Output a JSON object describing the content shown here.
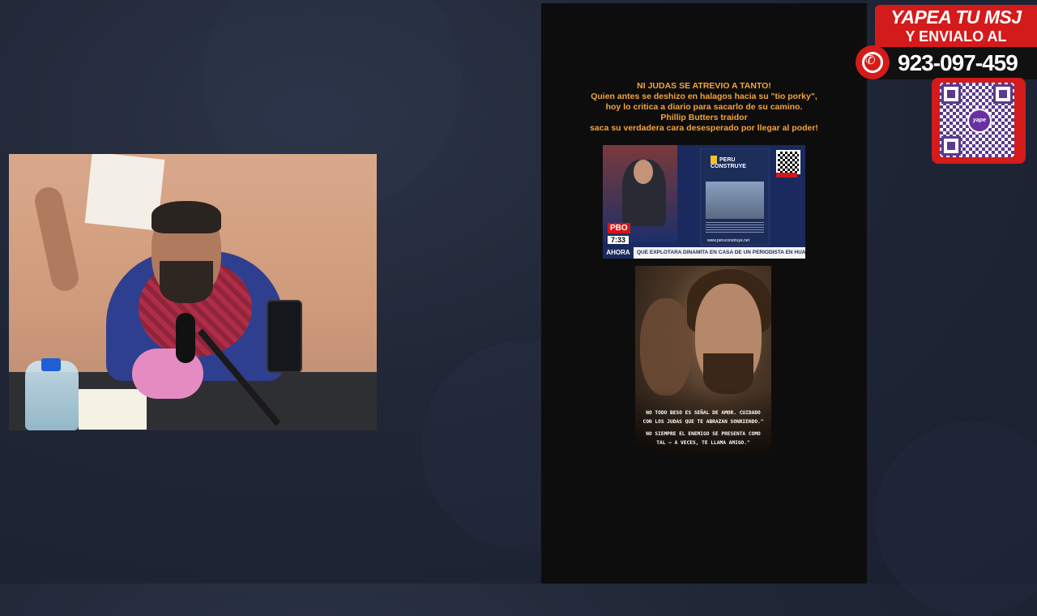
{
  "center": {
    "headline_lines": [
      "NI JUDAS SE ATREVIO A TANTO!",
      "Quien antes se deshizo en halagos hacia su \"tio porky\",",
      "hoy lo critica a diario para sacarlo de su camino.",
      "Phillip Butters traidor",
      "saca su verdadera cara desesperado por llegar al poder!"
    ],
    "news": {
      "channel": "PBO",
      "time": "7:33",
      "now_label": "AHORA",
      "ticker": "QUE EXPLOTARA DINAMITA EN CASA DE UN PERIODISTA EN HUAR",
      "ad_brand": "PERU CONSTRUYE",
      "ad_url": "www.peruconstruye.net"
    },
    "quote_lines": [
      "NO TODO BESO ES SEÑAL DE AMOR. CUIDADO",
      "CON LOS JUDAS QUE TE ABRAZAN SONRIENDO.\"",
      "NO SIEMPRE EL ENEMIGO SE PRESENTA COMO",
      "TAL — A VECES, TE LLAMA AMIGO.\""
    ]
  },
  "promo": {
    "line1": "YAPEA TU MSJ",
    "line2": "Y ENVIALO AL",
    "phone": "923-097-459",
    "qr_logo": "yape"
  },
  "colors": {
    "background": "#1f2636",
    "headline": "#f4a43a",
    "promo_red": "#d41b1b"
  }
}
